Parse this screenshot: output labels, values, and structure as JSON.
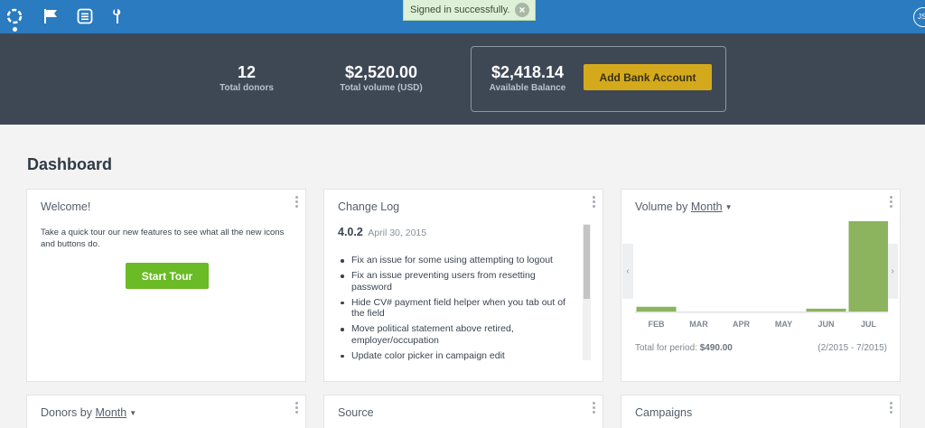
{
  "nav": {
    "icons": [
      "dashboard-ring-icon",
      "flag-icon",
      "list-icon",
      "wrench-icon"
    ],
    "avatar_initials": "JS"
  },
  "toast": {
    "message": "Signed in successfully."
  },
  "stats": {
    "donors_value": "12",
    "donors_label": "Total donors",
    "volume_value": "$2,520.00",
    "volume_label": "Total volume (USD)",
    "balance_value": "$2,418.14",
    "balance_label": "Available Balance",
    "add_bank_label": "Add Bank Account"
  },
  "dashboard": {
    "title": "Dashboard",
    "welcome": {
      "title": "Welcome!",
      "text": "Take a quick tour our new features to see what all the new icons and buttons do.",
      "button": "Start Tour"
    },
    "changelog": {
      "title": "Change Log",
      "version": "4.0.2",
      "date": "April 30, 2015",
      "items": [
        "Fix an issue for some using attempting to logout",
        "Fix an issue preventing users from resetting password",
        "Hide CV# payment field helper when you tab out of the field",
        "Move political statement above retired, employer/occupation",
        "Update color picker in campaign edit"
      ]
    },
    "volume": {
      "title_prefix": "Volume by",
      "title_link": "Month",
      "total_label": "Total for period:",
      "total_value": "$490.00",
      "range": "(2/2015 - 7/2015)"
    },
    "donors": {
      "title_prefix": "Donors by",
      "title_link": "Month"
    },
    "source": {
      "title": "Source"
    },
    "campaigns": {
      "title": "Campaigns"
    }
  },
  "chart_data": {
    "type": "bar",
    "categories": [
      "FEB",
      "MAR",
      "APR",
      "MAY",
      "JUN",
      "JUL"
    ],
    "values": [
      5,
      0,
      0,
      0,
      3,
      95
    ],
    "ylim": [
      0,
      95
    ],
    "colors": {
      "bar": "#8cb35e",
      "baseline": "#e0e0e0"
    }
  }
}
